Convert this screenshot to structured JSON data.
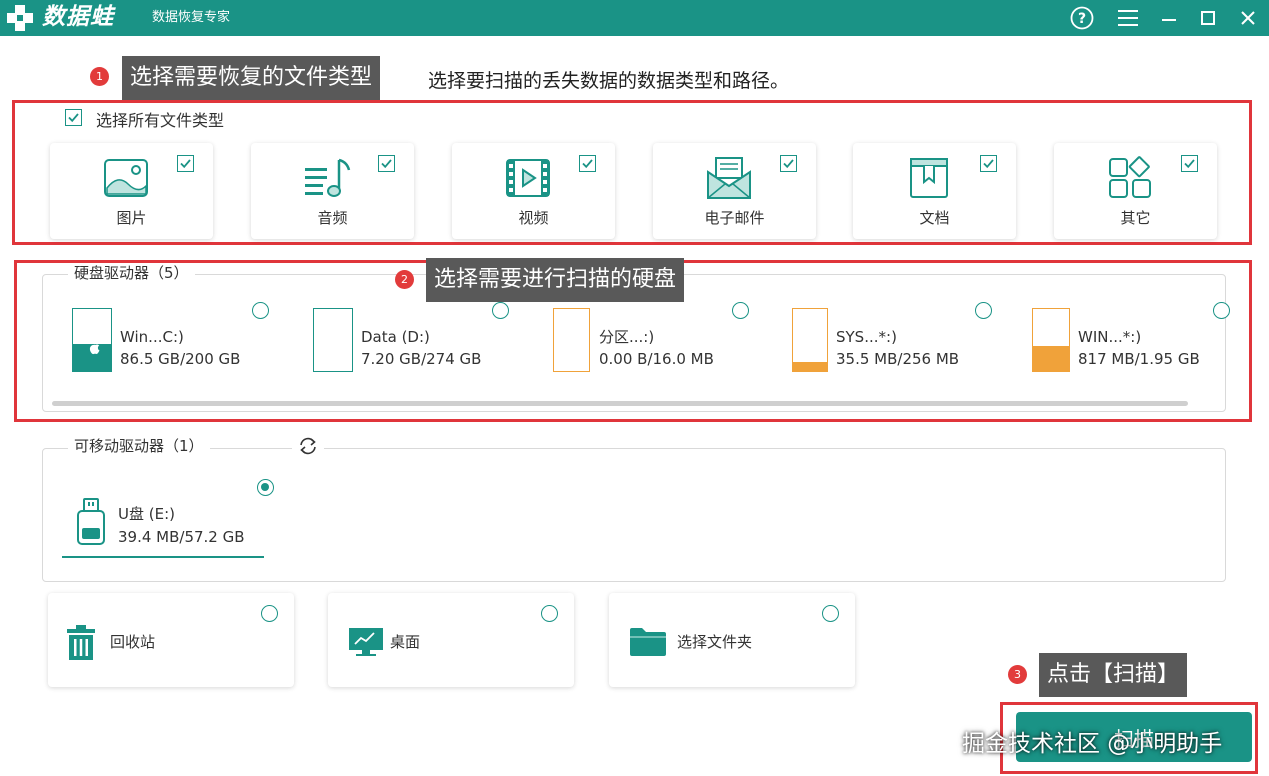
{
  "window": {
    "logo_text": "数据蛙",
    "app_name": "数据恢复专家",
    "help_label": "?"
  },
  "annotations": {
    "step1_num": "1",
    "step1_label": "选择需要恢复的文件类型",
    "step2_num": "2",
    "step2_label": "选择需要进行扫描的硬盘",
    "step3_num": "3",
    "step3_label": "点击【扫描】"
  },
  "instruction": "选择要扫描的丢失数据的数据类型和路径。",
  "file_types": {
    "select_all_label": "选择所有文件类型",
    "select_all_checked": true,
    "items": [
      {
        "label": "图片",
        "icon": "image-icon",
        "checked": true
      },
      {
        "label": "音频",
        "icon": "audio-icon",
        "checked": true
      },
      {
        "label": "视频",
        "icon": "video-icon",
        "checked": true
      },
      {
        "label": "电子邮件",
        "icon": "email-icon",
        "checked": true
      },
      {
        "label": "文档",
        "icon": "document-icon",
        "checked": true
      },
      {
        "label": "其它",
        "icon": "other-icon",
        "checked": true
      }
    ]
  },
  "hard_drives": {
    "title": "硬盘驱动器（5）",
    "items": [
      {
        "name": "Win...C:)",
        "size": "86.5 GB/200 GB",
        "used_fraction": 0.43,
        "color": "#1a9386",
        "selected": false,
        "os_icon": true
      },
      {
        "name": "Data (D:)",
        "size": "7.20 GB/274 GB",
        "used_fraction": 0.0,
        "color": "#1a9386",
        "selected": false
      },
      {
        "name": "分区...:)",
        "size": "0.00  B/16.0 MB",
        "used_fraction": 0.0,
        "color": "#f0a23a",
        "selected": false
      },
      {
        "name": "SYS...*:)",
        "size": "35.5 MB/256 MB",
        "used_fraction": 0.14,
        "color": "#f0a23a",
        "selected": false
      },
      {
        "name": "WIN...*:)",
        "size": "817 MB/1.95 GB",
        "used_fraction": 0.41,
        "color": "#f0a23a",
        "selected": false
      }
    ]
  },
  "removable": {
    "title": "可移动驱动器（1）",
    "items": [
      {
        "name": "U盘 (E:)",
        "size": "39.4 MB/57.2 GB",
        "selected": true
      }
    ]
  },
  "locations": [
    {
      "label": "回收站",
      "icon": "recycle-bin-icon",
      "selected": false
    },
    {
      "label": "桌面",
      "icon": "desktop-icon",
      "selected": false
    },
    {
      "label": "选择文件夹",
      "icon": "folder-icon",
      "selected": false
    }
  ],
  "scan_button": "扫描",
  "watermark": "掘金技术社区 @小明助手",
  "colors": {
    "accent": "#1a9386",
    "annotation_red": "#e0353b",
    "annotation_label_bg": "#595959",
    "partition_orange": "#f0a23a"
  }
}
